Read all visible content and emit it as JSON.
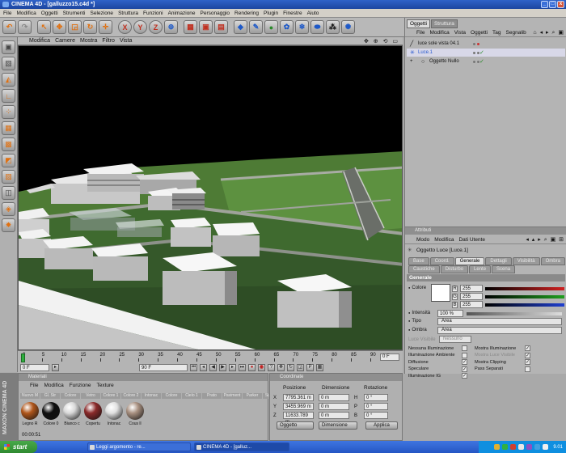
{
  "window": {
    "title": "CINEMA 4D - [galluzzo15.c4d *]",
    "buttons": [
      "_",
      "□",
      "x"
    ]
  },
  "main_menu": [
    "File",
    "Modifica",
    "Oggetti",
    "Strumenti",
    "Selezione",
    "Struttura",
    "Funzioni",
    "Animazione",
    "Personaggio",
    "Rendering",
    "Plugin",
    "Finestre",
    "Aiuto"
  ],
  "viewport": {
    "menu": [
      "Modifica",
      "Camere",
      "Mostra",
      "Filtro",
      "Vista"
    ],
    "icons": "✥ ⊕ ⟲ ▭"
  },
  "timeline": {
    "ticks": [
      "0",
      "5",
      "10",
      "15",
      "20",
      "25",
      "30",
      "35",
      "40",
      "45",
      "50",
      "55",
      "60",
      "65",
      "70",
      "75",
      "80",
      "85",
      "90"
    ],
    "end_frame": "0 F",
    "current_frame": "0 F",
    "start_field": "0 F",
    "end_field": "90 F"
  },
  "materials": {
    "title": "Materiali",
    "menu": [
      "File",
      "Modifica",
      "Funzione",
      "Texture"
    ],
    "labels": [
      "Nuovo M",
      "Gl. Str",
      "Colore",
      "Vetro",
      "Colore 1",
      "Colore 2",
      "Intonac",
      "Colore",
      "Cielo 1",
      "Prato",
      "Paviment",
      "Parker",
      "Suppost"
    ],
    "balls": [
      {
        "name": "Legno R",
        "color": "#b0561a"
      },
      {
        "name": "Colore 0",
        "color": "#0e0e0e"
      },
      {
        "name": "Bianco c",
        "color": "#d8d8d8"
      },
      {
        "name": "Copertu",
        "color": "#8a2a2a"
      },
      {
        "name": "Intonac",
        "color": "#e0e0e0"
      },
      {
        "name": "Cous ll",
        "color": "#a89080"
      }
    ],
    "status": "00:00:51"
  },
  "coordinates": {
    "title": "Coordinate",
    "headers": [
      "Posizione",
      "Dimensione",
      "Rotazione"
    ],
    "rows": [
      {
        "axis": "X",
        "pos": "7795.361 m",
        "dim": "0 m",
        "rot_axis": "H",
        "rot": "0 °"
      },
      {
        "axis": "Y",
        "pos": "3455.969 m",
        "dim": "0 m",
        "rot_axis": "P",
        "rot": "0 °"
      },
      {
        "axis": "Z",
        "pos": "11633.789 m",
        "dim": "0 m",
        "rot_axis": "B",
        "rot": "0 °"
      }
    ],
    "mode_buttons": [
      "Oggetto",
      "Dimensione"
    ],
    "apply": "Applica"
  },
  "object_manager": {
    "tabs": [
      "Oggetti",
      "Struttura"
    ],
    "menu": [
      "File",
      "Modifica",
      "Vista",
      "Oggetti",
      "Tag",
      "Segnalib"
    ],
    "objects": [
      {
        "name": "luce sole vista 04.1",
        "icon": "╱"
      },
      {
        "name": "Luce.1",
        "icon": "✳"
      },
      {
        "name": "Oggetto Nullo",
        "icon": "○"
      }
    ]
  },
  "attributes": {
    "title": "Attributi",
    "menu": [
      "Modo",
      "Modifica",
      "Dati Utente"
    ],
    "object": "Oggetto Luce [Luce.1]",
    "tabs_row1": [
      "Base",
      "Coord.",
      "Generale",
      "Dettagli",
      "Visibilità",
      "Ombra"
    ],
    "tabs_row2": [
      "Caustiche",
      "Disturbo",
      "Lente",
      "Scena"
    ],
    "section": "Generale",
    "color_label": "Colore",
    "rgb": [
      {
        "ch": "R",
        "val": "255",
        "color": "#d02020"
      },
      {
        "ch": "G",
        "val": "255",
        "color": "#20a020"
      },
      {
        "ch": "B",
        "val": "255",
        "color": "#2040d0"
      }
    ],
    "intensity_label": "Intensità",
    "intensity": "100 %",
    "type_label": "Tipo",
    "type": "Area",
    "shadow_label": "Ombra",
    "shadow": "Area",
    "visible_light_label": "Luce Visibile",
    "visible_light": "Nessuno",
    "checks_left": [
      {
        "label": "Nessuna Illuminazione",
        "checked": false
      },
      {
        "label": "Illuminazione Ambiente",
        "checked": false
      },
      {
        "label": "Diffusione",
        "checked": true
      },
      {
        "label": "Speculare",
        "checked": true
      },
      {
        "label": "Illuminazione IG",
        "checked": true
      }
    ],
    "checks_right": [
      {
        "label": "Mostra Illuminazione",
        "checked": true,
        "disabled": false
      },
      {
        "label": "Mostra Luce Visibile",
        "checked": true,
        "disabled": true
      },
      {
        "label": "Mostra Clipping",
        "checked": true,
        "disabled": false
      },
      {
        "label": "Pass Separati",
        "checked": false,
        "disabled": false
      }
    ]
  },
  "taskbar": {
    "start": "start",
    "tasks": [
      "Leggi argomento - re...",
      "CINEMA 4D - [galluz..."
    ],
    "clock": "9.01"
  },
  "colors": {
    "accent_orange": "#e07010",
    "accent_blue": "#1d59c8",
    "grass": "#5a8a3c",
    "taskbar": "#2556c4"
  }
}
